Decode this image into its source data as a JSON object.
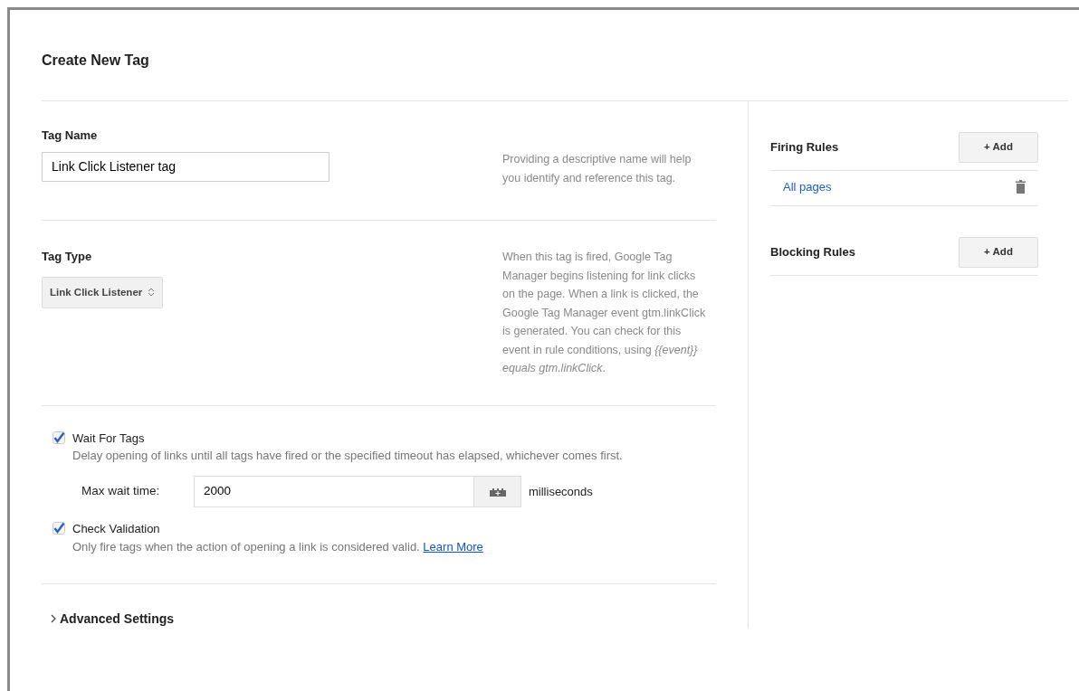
{
  "title": "Create New Tag",
  "tag_name": {
    "label": "Tag Name",
    "value": "Link Click Listener tag",
    "help": "Providing a descriptive name will help you identify and reference this tag."
  },
  "tag_type": {
    "label": "Tag Type",
    "value": "Link Click Listener",
    "help": "When this tag is fired, Google Tag Manager begins listening for link clicks on the page. When a link is clicked, the Google Tag Manager event gtm.linkClick is generated. You can check for this event in rule conditions, using *{{event}} equals gtm.linkClick*."
  },
  "options": [
    {
      "label": "Wait For Tags",
      "checked": true,
      "description": "Delay opening of links until all tags have fired or the specified timeout has elapsed, whichever comes first.",
      "field": {
        "label": "Max wait time:",
        "value": "2000",
        "unit": "milliseconds"
      }
    },
    {
      "label": "Check Validation",
      "checked": true,
      "description": "Only fire tags when the action of opening a link is considered valid.",
      "link": "Learn More"
    }
  ],
  "advanced": {
    "label": "Advanced Settings",
    "expanded": false
  },
  "rules": [
    {
      "title": "Firing Rules",
      "button": "+ Add",
      "items": [
        {
          "label": "All pages"
        }
      ]
    },
    {
      "title": "Blocking Rules",
      "button": "+ Add"
    }
  ]
}
